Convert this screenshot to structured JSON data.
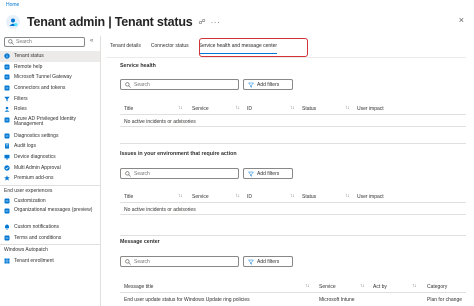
{
  "breadcrumb": "Home",
  "header": {
    "title": "Tenant admin | Tenant status",
    "more": "···",
    "close": "×"
  },
  "sidebar": {
    "search_placeholder": "Search",
    "collapse": "«",
    "items": [
      {
        "label": "Tenant status",
        "icon": "info-icon",
        "active": true
      },
      {
        "label": "Remote help",
        "icon": "remote-help-icon"
      },
      {
        "label": "Microsoft Tunnel Gateway",
        "icon": "tunnel-icon"
      },
      {
        "label": "Connectors and tokens",
        "icon": "connector-icon"
      },
      {
        "label": "Filters",
        "icon": "filter-icon"
      },
      {
        "label": "Roles",
        "icon": "roles-icon"
      },
      {
        "label": "Azure AD Privileged Identity Management",
        "icon": "pim-icon",
        "two_line": true
      },
      {
        "label": "Diagnostics settings",
        "icon": "diagnostics-icon"
      },
      {
        "label": "Audit logs",
        "icon": "audit-icon"
      },
      {
        "label": "Device diagnostics",
        "icon": "device-icon"
      },
      {
        "label": "Multi Admin Approval",
        "icon": "approval-icon"
      },
      {
        "label": "Premium add-ons",
        "icon": "premium-icon"
      }
    ],
    "section1": "End user experiences",
    "items2": [
      {
        "label": "Customization",
        "icon": "customization-icon"
      },
      {
        "label": "Organizational messages (preview)",
        "icon": "messages-icon",
        "two_line": true
      },
      {
        "label": "Custom notifications",
        "icon": "notification-icon"
      },
      {
        "label": "Terms and conditions",
        "icon": "terms-icon"
      }
    ],
    "section2": "Windows Autopatch",
    "items3": [
      {
        "label": "Tenant enrollment",
        "icon": "enrollment-icon"
      }
    ]
  },
  "tabs": [
    {
      "label": "Tenant details"
    },
    {
      "label": "Connector status"
    },
    {
      "label": "Service health and message center",
      "selected": true
    }
  ],
  "service_health": {
    "title": "Service health",
    "search_placeholder": "Search",
    "add_filters": "Add filters",
    "columns": [
      "Title",
      "Service",
      "ID",
      "Status",
      "User impact"
    ],
    "empty": "No active incidents or advisories"
  },
  "issues": {
    "title": "Issues in your environment that require action",
    "search_placeholder": "Search",
    "add_filters": "Add filters",
    "columns": [
      "Title",
      "Service",
      "ID",
      "Status",
      "User impact"
    ],
    "empty": "No active incidents or advisories"
  },
  "message_center": {
    "title": "Message center",
    "search_placeholder": "Search",
    "add_filters": "Add filters",
    "columns": [
      "Message title",
      "Service",
      "Act by",
      "Category"
    ],
    "rows": [
      {
        "title": "End user update status for Windows Update ring policies",
        "service": "Microsoft Intune",
        "act_by": "",
        "category": "Plan for change"
      }
    ]
  },
  "colors": {
    "accent": "#0078d4",
    "highlight": "#d13438"
  }
}
